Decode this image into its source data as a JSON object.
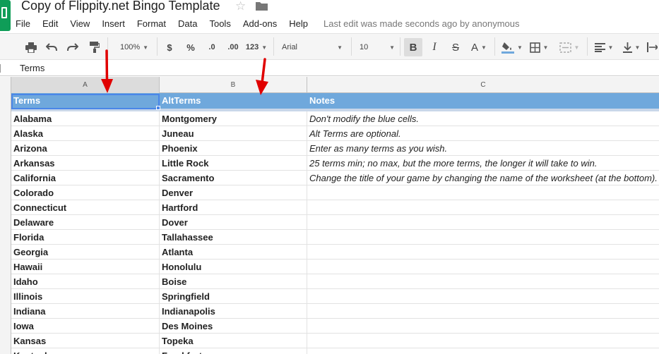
{
  "app": {
    "title": "Copy of Flippity.net Bingo Template",
    "last_edit": "Last edit was made seconds ago by anonymous"
  },
  "menu": [
    "File",
    "Edit",
    "View",
    "Insert",
    "Format",
    "Data",
    "Tools",
    "Add-ons",
    "Help"
  ],
  "toolbar": {
    "zoom": "100%",
    "currency": "$",
    "percent": "%",
    "decrease_decimals": ".0",
    "increase_decimals": ".00",
    "more_formats": "123",
    "font": "Arial",
    "font_size": "10",
    "bold": "B",
    "italic": "I",
    "strikethrough": "S",
    "text_color": "A"
  },
  "formula_bar": {
    "value": "Terms"
  },
  "columns": [
    "A",
    "B",
    "C"
  ],
  "header": {
    "a": "Terms",
    "b": "AltTerms",
    "c": "Notes"
  },
  "rows": [
    {
      "a": "Alabama",
      "b": "Montgomery",
      "c": "Don't modify the blue cells."
    },
    {
      "a": "Alaska",
      "b": "Juneau",
      "c": "Alt Terms are optional."
    },
    {
      "a": "Arizona",
      "b": "Phoenix",
      "c": "Enter as many terms as you wish."
    },
    {
      "a": "Arkansas",
      "b": "Little Rock",
      "c": "25 terms min; no max, but the more terms, the longer it will take to win."
    },
    {
      "a": "California",
      "b": "Sacramento",
      "c": "Change the title of your game by changing the name of the worksheet (at the bottom)."
    },
    {
      "a": "Colorado",
      "b": "Denver",
      "c": ""
    },
    {
      "a": "Connecticut",
      "b": "Hartford",
      "c": ""
    },
    {
      "a": "Delaware",
      "b": "Dover",
      "c": ""
    },
    {
      "a": "Florida",
      "b": "Tallahassee",
      "c": ""
    },
    {
      "a": "Georgia",
      "b": "Atlanta",
      "c": ""
    },
    {
      "a": "Hawaii",
      "b": "Honolulu",
      "c": ""
    },
    {
      "a": "Idaho",
      "b": "Boise",
      "c": ""
    },
    {
      "a": "Illinois",
      "b": "Springfield",
      "c": ""
    },
    {
      "a": "Indiana",
      "b": "Indianapolis",
      "c": ""
    },
    {
      "a": "Iowa",
      "b": "Des Moines",
      "c": ""
    },
    {
      "a": "Kansas",
      "b": "Topeka",
      "c": ""
    },
    {
      "a": "Kentucky",
      "b": "Frankfort",
      "c": ""
    }
  ],
  "colors": {
    "header_blue": "#6fa8dc",
    "selection": "#4a86e8",
    "arrow": "#e00000",
    "brand_green": "#0f9d58"
  }
}
